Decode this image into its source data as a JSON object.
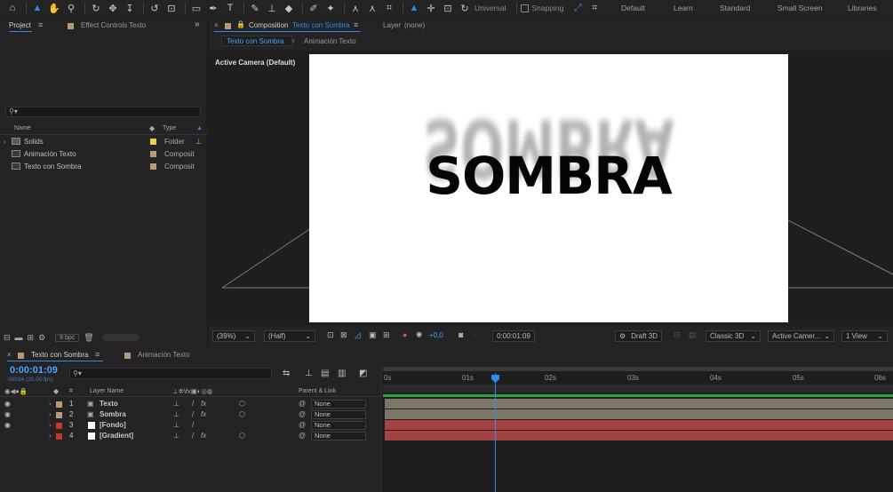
{
  "toolbar": {
    "tools": [
      "home-icon",
      "selection-icon",
      "hand-icon",
      "zoom-icon",
      "orbit-icon",
      "pan-icon",
      "dolly-icon",
      "rotate-icon",
      "shape-icon",
      "pen-icon",
      "type-icon",
      "brush-icon",
      "clone-icon",
      "eraser-icon",
      "roto-icon",
      "puppet-icon"
    ],
    "axis_mode": "Universal",
    "snapping": "Snapping",
    "workspaces": [
      "Default",
      "Learn",
      "Standard",
      "Small Screen",
      "Libraries"
    ]
  },
  "project": {
    "tab_label": "Project",
    "effect_controls_label": "Effect Controls",
    "effect_controls_target": "Texto",
    "col_name": "Name",
    "col_type": "Type",
    "items": [
      {
        "name": "Solids",
        "type": "Folder",
        "color": "#e8d14a"
      },
      {
        "name": "Animación Texto",
        "type": "Composit",
        "color": "#b89a78"
      },
      {
        "name": "Texto con Sombra",
        "type": "Composit",
        "color": "#b89a78"
      }
    ],
    "bpc": "8 bpc"
  },
  "composition": {
    "tab_prefix": "Composition",
    "tab_name": "Texto con Sombra",
    "layer_label": "Layer",
    "layer_value": "(none)",
    "subtabs": [
      "Texto con Sombra",
      "Animación Texto"
    ],
    "camera_label": "Active Camera (Default)",
    "canvas_text": "SOMBRA",
    "shadow_text": "SOMBRA",
    "zoom": "(39%)",
    "resolution": "(Half)",
    "exposure": "+0,0",
    "timecode": "0:00:01:09",
    "draft": "Draft 3D",
    "renderer": "Classic 3D",
    "camera_select": "Active Camer...",
    "views": "1 View"
  },
  "timeline": {
    "tabs": [
      "Texto con Sombra",
      "Animación Texto"
    ],
    "timecode": "0:00:01:09",
    "frames": "00034 (25.00 fps)",
    "col_layer_name": "Layer Name",
    "col_parent": "Parent & Link",
    "col_num": "#",
    "ruler": [
      "0s",
      "01s",
      "02s",
      "03s",
      "04s",
      "05s",
      "06s"
    ],
    "playhead_fraction": 0.216,
    "layers": [
      {
        "num": "1",
        "name": "Texto",
        "color": "#b89a78",
        "parent": "None",
        "bar": "#7d7668"
      },
      {
        "num": "2",
        "name": "Sombra",
        "color": "#b89a78",
        "parent": "None",
        "bar": "#7d7668"
      },
      {
        "num": "3",
        "name": "[Fondo]",
        "color": "#c0392b",
        "parent": "None",
        "bar": "#a44141"
      },
      {
        "num": "4",
        "name": "[Gradient]",
        "color": "#c0392b",
        "parent": "None",
        "bar": "#a44141"
      }
    ]
  }
}
